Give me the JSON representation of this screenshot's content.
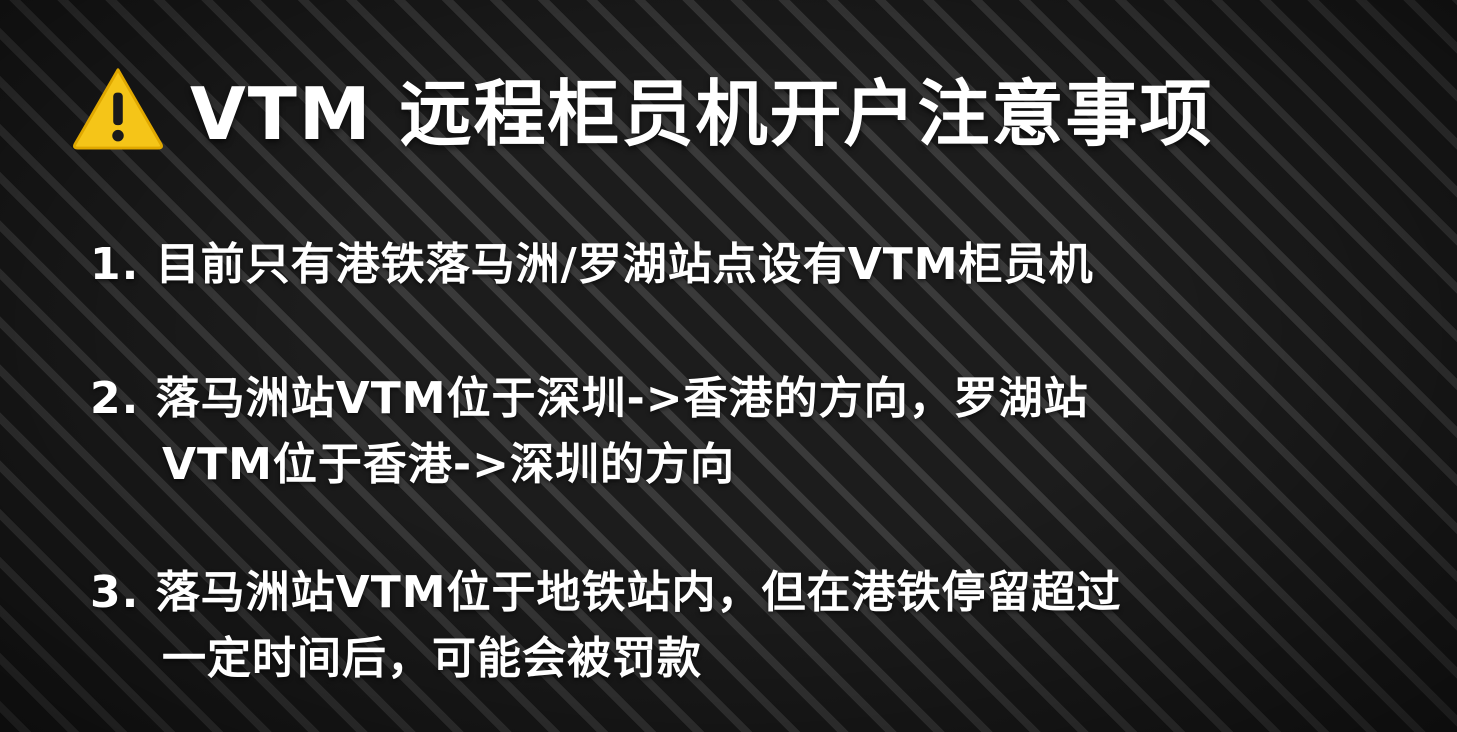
{
  "header": {
    "warning_icon": "warning-icon",
    "title": "VTM 远程柜员机开户注意事项"
  },
  "items": [
    {
      "lines": [
        "1. 目前只有港铁落马洲/罗湖站点设有VTM柜员机"
      ]
    },
    {
      "lines": [
        "2. 落马洲站VTM位于深圳->香港的方向，罗湖站",
        "VTM位于香港->深圳的方向"
      ]
    },
    {
      "lines": [
        "3. 落马洲站VTM位于地铁站内，但在港铁停留超过",
        "一定时间后，可能会被罚款"
      ]
    }
  ],
  "colors": {
    "warning_fill": "#F5C518",
    "text": "#FFFFFF",
    "background": "#262626"
  }
}
